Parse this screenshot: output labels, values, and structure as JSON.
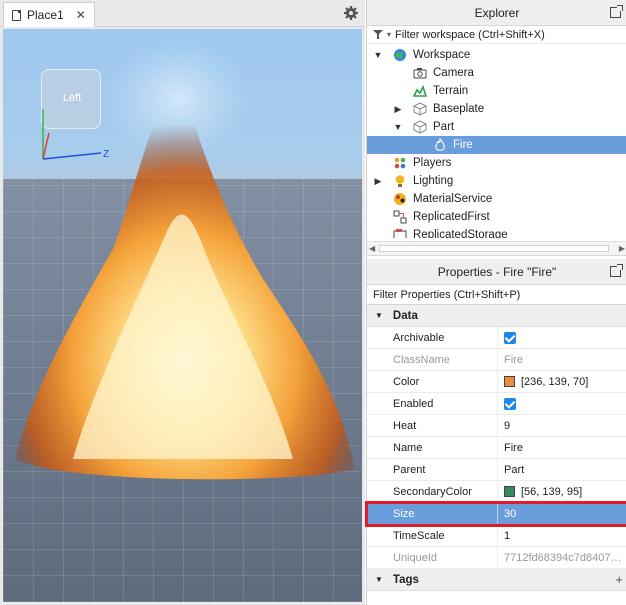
{
  "tabs": {
    "active_label": "Place1",
    "close_glyph": "✕"
  },
  "viewport": {
    "view_cube_face": "Left",
    "axis_z_label": "Z"
  },
  "explorer": {
    "title": "Explorer",
    "filter_placeholder": "Filter workspace (Ctrl+Shift+X)",
    "items": [
      {
        "label": "Workspace",
        "icon": "globe-icon",
        "expanded": true
      },
      {
        "label": "Camera",
        "icon": "camera-icon"
      },
      {
        "label": "Terrain",
        "icon": "terrain-icon"
      },
      {
        "label": "Baseplate",
        "icon": "part-icon",
        "collapsed": true
      },
      {
        "label": "Part",
        "icon": "part-icon",
        "expanded": true
      },
      {
        "label": "Fire",
        "icon": "fire-icon",
        "selected": true
      },
      {
        "label": "Players",
        "icon": "players-icon"
      },
      {
        "label": "Lighting",
        "icon": "lightbulb-icon",
        "collapsed": true
      },
      {
        "label": "MaterialService",
        "icon": "material-icon"
      },
      {
        "label": "ReplicatedFirst",
        "icon": "replicated-icon"
      },
      {
        "label": "ReplicatedStorage",
        "icon": "storage-icon"
      }
    ]
  },
  "properties": {
    "title": "Properties - Fire \"Fire\"",
    "filter_placeholder": "Filter Properties (Ctrl+Shift+P)",
    "section_data": "Data",
    "section_tags": "Tags",
    "rows": [
      {
        "name": "Archivable",
        "value": "",
        "checkbox": true
      },
      {
        "name": "ClassName",
        "value": "Fire",
        "muted": true
      },
      {
        "name": "Color",
        "value": "[236, 139, 70]",
        "swatch": "#ec8b46"
      },
      {
        "name": "Enabled",
        "value": "",
        "checkbox": true
      },
      {
        "name": "Heat",
        "value": "9"
      },
      {
        "name": "Name",
        "value": "Fire"
      },
      {
        "name": "Parent",
        "value": "Part"
      },
      {
        "name": "SecondaryColor",
        "value": "[56, 139, 95]",
        "swatch": "#388b5f"
      },
      {
        "name": "Size",
        "value": "30",
        "selected": true
      },
      {
        "name": "TimeScale",
        "value": "1"
      },
      {
        "name": "UniqueId",
        "value": "7712fd68394c7d8407…",
        "muted": true
      }
    ]
  },
  "colors": {
    "selection": "#6a9ddb",
    "highlight_outline": "#e01b2a",
    "checkbox": "#1e88e5"
  }
}
